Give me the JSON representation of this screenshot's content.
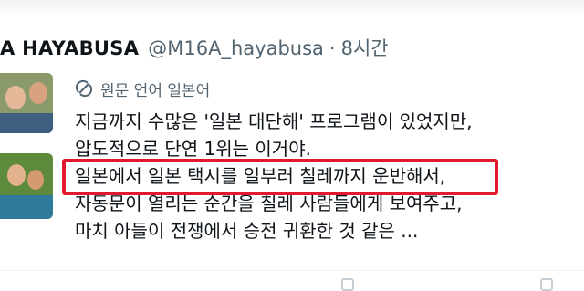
{
  "tweet": {
    "display_name": "A HAYABUSA",
    "handle": "@M16A_hayabusa",
    "separator": "·",
    "time": "8시간",
    "translation_label": "원문 언어 일본어",
    "lines": [
      "지금까지 수많은 '일본 대단해' 프로그램이 있었지만,",
      "압도적으로 단연 1위는 이거야.",
      "일본에서 일본 택시를 일부러 칠레까지 운반해서,",
      "자동문이 열리는 순간을 칠레 사람들에게 보여주고,",
      "마치 아들이 전쟁에서 승전 귀환한 것 같은 ..."
    ]
  },
  "icons": {
    "translate": "translate-icon",
    "action_reply": "reply-icon",
    "action_share": "share-icon"
  },
  "colors": {
    "highlight": "#e0192f",
    "muted_text": "#536471",
    "primary_text": "#0f1419"
  }
}
